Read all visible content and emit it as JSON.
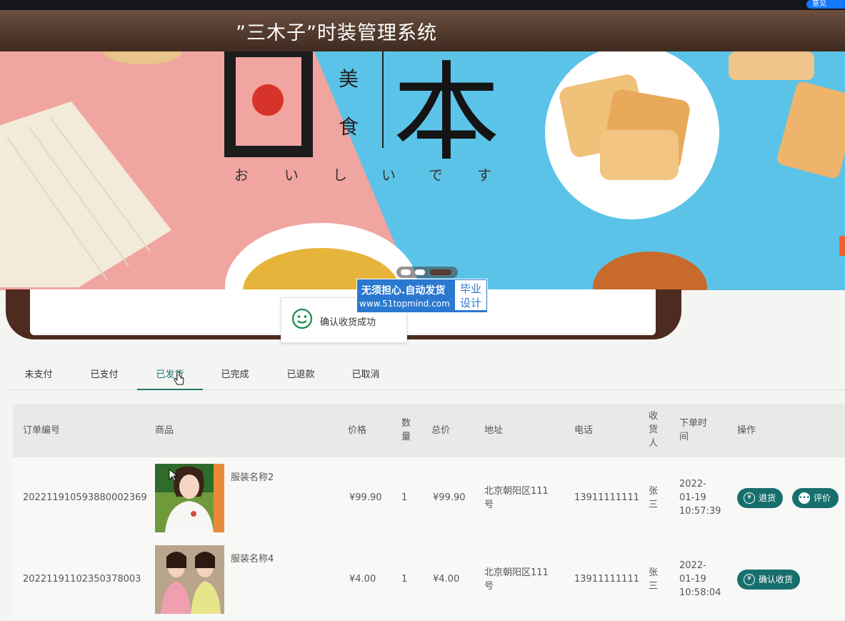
{
  "feedback": {
    "label": "意见"
  },
  "header": {
    "title": "”三木子”时装管理系统"
  },
  "banner": {
    "big_char": "本",
    "small_chars": [
      "美",
      "食"
    ],
    "kana": [
      "お",
      "い",
      "し",
      "い",
      "で",
      "す"
    ]
  },
  "toast": {
    "message": "确认收货成功"
  },
  "watermark": {
    "line1": "无须担心.自动发货",
    "line2": "www.51topmind.com",
    "box_line1": "毕业",
    "box_line2": "设计"
  },
  "tabs": [
    {
      "label": "未支付",
      "active": false
    },
    {
      "label": "已支付",
      "active": false
    },
    {
      "label": "已发货",
      "active": true
    },
    {
      "label": "已完成",
      "active": false
    },
    {
      "label": "已退款",
      "active": false
    },
    {
      "label": "已取消",
      "active": false
    }
  ],
  "table": {
    "headers": {
      "order_no": "订单编号",
      "product": "商品",
      "price": "价格",
      "qty": "数量",
      "total": "总价",
      "address": "地址",
      "phone": "电话",
      "receiver": "收货人",
      "order_time": "下单时间",
      "action": "操作"
    },
    "rows": [
      {
        "order_no": "20221191059388000236 9",
        "product_name": "服装名称2",
        "price": "¥99.90",
        "qty": "1",
        "total": "¥99.90",
        "address_1": "北京朝阳区111",
        "address_2": "号",
        "phone": "13911111111",
        "receiver_1": "张",
        "receiver_2": "三",
        "time_1": "2022-",
        "time_2": "01-19",
        "time_3": "10:57:39",
        "actions": [
          "退货",
          "评价"
        ]
      },
      {
        "order_no": "20221191102350378003",
        "product_name": "服装名称4",
        "price": "¥4.00",
        "qty": "1",
        "total": "¥4.00",
        "address_1": "北京朝阳区111",
        "address_2": "号",
        "phone": "13911111111",
        "receiver_1": "张",
        "receiver_2": "三",
        "time_1": "2022-",
        "time_2": "01-19",
        "time_3": "10:58:04",
        "actions": [
          "确认收货"
        ]
      }
    ]
  },
  "colors": {
    "header": "#5a3e31",
    "accent": "#176f6d",
    "banner_blue": "#5cc3e8",
    "banner_pink": "#f0a5a0"
  }
}
